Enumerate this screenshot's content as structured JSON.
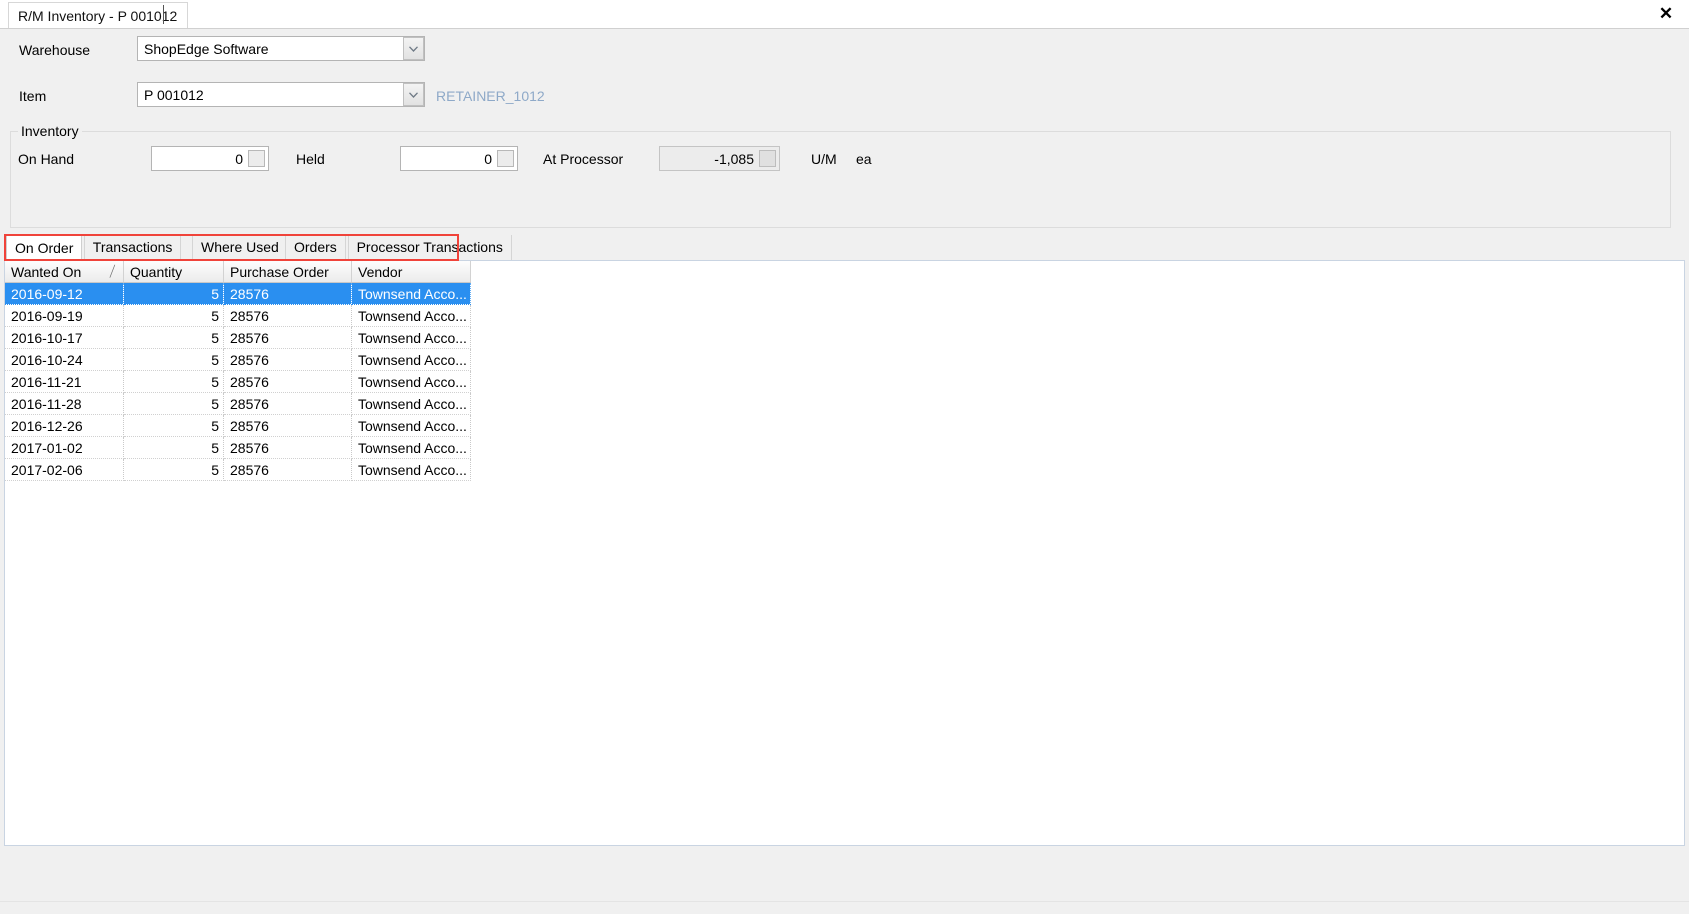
{
  "window": {
    "tab_title": "R/M Inventory - P 001012",
    "close_label": "✕"
  },
  "header": {
    "warehouse_label": "Warehouse",
    "warehouse_value": "ShopEdge Software",
    "item_label": "Item",
    "item_value": "P 001012",
    "item_description": "RETAINER_1012"
  },
  "inventory": {
    "legend": "Inventory",
    "on_hand_label": "On Hand",
    "on_hand_value": "0",
    "held_label": "Held",
    "held_value": "0",
    "at_processor_label": "At Processor",
    "at_processor_value": "-1,085",
    "um_label": "U/M",
    "um_value": "ea"
  },
  "tabs": {
    "highlight_color": "#f0433a",
    "items": [
      {
        "label": "On Order",
        "active": true
      },
      {
        "label": "Transactions",
        "active": false
      },
      {
        "label": "Where Used",
        "active": false
      },
      {
        "label": "Orders",
        "active": false
      },
      {
        "label": "Processor Transactions",
        "active": false
      }
    ]
  },
  "grid": {
    "sort_column": "Wanted On",
    "sort_direction": "ascending",
    "sort_glyph": "╱",
    "columns": [
      {
        "label": "Wanted On",
        "key": "wanted_on",
        "align": "left"
      },
      {
        "label": "Quantity",
        "key": "quantity",
        "align": "right"
      },
      {
        "label": "Purchase Order",
        "key": "purchase_order",
        "align": "left"
      },
      {
        "label": "Vendor",
        "key": "vendor",
        "align": "left"
      }
    ],
    "rows": [
      {
        "wanted_on": "2016-09-12",
        "quantity": "5",
        "purchase_order": "28576",
        "vendor": "Townsend Acco...",
        "selected": true
      },
      {
        "wanted_on": "2016-09-19",
        "quantity": "5",
        "purchase_order": "28576",
        "vendor": "Townsend Acco...",
        "selected": false
      },
      {
        "wanted_on": "2016-10-17",
        "quantity": "5",
        "purchase_order": "28576",
        "vendor": "Townsend Acco...",
        "selected": false
      },
      {
        "wanted_on": "2016-10-24",
        "quantity": "5",
        "purchase_order": "28576",
        "vendor": "Townsend Acco...",
        "selected": false
      },
      {
        "wanted_on": "2016-11-21",
        "quantity": "5",
        "purchase_order": "28576",
        "vendor": "Townsend Acco...",
        "selected": false
      },
      {
        "wanted_on": "2016-11-28",
        "quantity": "5",
        "purchase_order": "28576",
        "vendor": "Townsend Acco...",
        "selected": false
      },
      {
        "wanted_on": "2016-12-26",
        "quantity": "5",
        "purchase_order": "28576",
        "vendor": "Townsend Acco...",
        "selected": false
      },
      {
        "wanted_on": "2017-01-02",
        "quantity": "5",
        "purchase_order": "28576",
        "vendor": "Townsend Acco...",
        "selected": false
      },
      {
        "wanted_on": "2017-02-06",
        "quantity": "5",
        "purchase_order": "28576",
        "vendor": "Townsend Acco...",
        "selected": false
      }
    ]
  }
}
